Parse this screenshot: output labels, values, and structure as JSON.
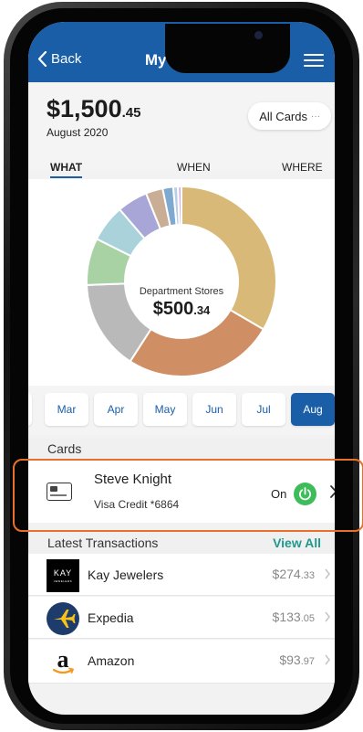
{
  "header": {
    "back_label": "Back",
    "title": "My Spend"
  },
  "summary": {
    "amount_main": "$1,500",
    "amount_cents": ".45",
    "period": "August 2020",
    "filter_label": "All Cards",
    "filter_more": "···"
  },
  "tabs": [
    {
      "label": "WHAT",
      "active": true
    },
    {
      "label": "WHEN",
      "active": false
    },
    {
      "label": "WHERE",
      "active": false
    }
  ],
  "chart_data": {
    "type": "pie",
    "style": "donut",
    "center_label": "Department Stores",
    "center_value_main": "$500",
    "center_value_cents": ".34",
    "slices": [
      {
        "value": 33.4,
        "color": "#d8b978"
      },
      {
        "value": 25.7,
        "color": "#cf8e63"
      },
      {
        "value": 15.3,
        "color": "#b9b9b9"
      },
      {
        "value": 8.0,
        "color": "#a8d2a4"
      },
      {
        "value": 6.3,
        "color": "#a9d2db"
      },
      {
        "value": 5.2,
        "color": "#a8a6d6"
      },
      {
        "value": 2.9,
        "color": "#c9ad95"
      },
      {
        "value": 1.8,
        "color": "#7fa9cf"
      },
      {
        "value": 0.8,
        "color": "#b7cfe6"
      },
      {
        "value": 0.6,
        "color": "#d6b3df"
      }
    ]
  },
  "months": [
    {
      "label": "Mar",
      "active": false
    },
    {
      "label": "Apr",
      "active": false
    },
    {
      "label": "May",
      "active": false
    },
    {
      "label": "Jun",
      "active": false
    },
    {
      "label": "Jul",
      "active": false
    },
    {
      "label": "Aug",
      "active": true
    }
  ],
  "cards_section": {
    "title": "Cards"
  },
  "card": {
    "name": "Steve Knight",
    "detail": "Visa Credit *6864",
    "status": "On",
    "status_color": "#3dbd5a"
  },
  "transactions_section": {
    "title": "Latest Transactions",
    "view_all": "View All"
  },
  "transactions": [
    {
      "merchant": "Kay Jewelers",
      "amount_main": "$274",
      "amount_cents": ".33",
      "logo_text": "KAY",
      "logo_subtext": "JEWELERS"
    },
    {
      "merchant": "Expedia",
      "amount_main": "$133",
      "amount_cents": ".05"
    },
    {
      "merchant": "Amazon",
      "amount_main": "$93",
      "amount_cents": ".97",
      "logo_text": "a"
    }
  ],
  "colors": {
    "brand_blue": "#1a5ea8",
    "accent_teal": "#1e9a8c",
    "highlight_orange": "#e8702a"
  }
}
